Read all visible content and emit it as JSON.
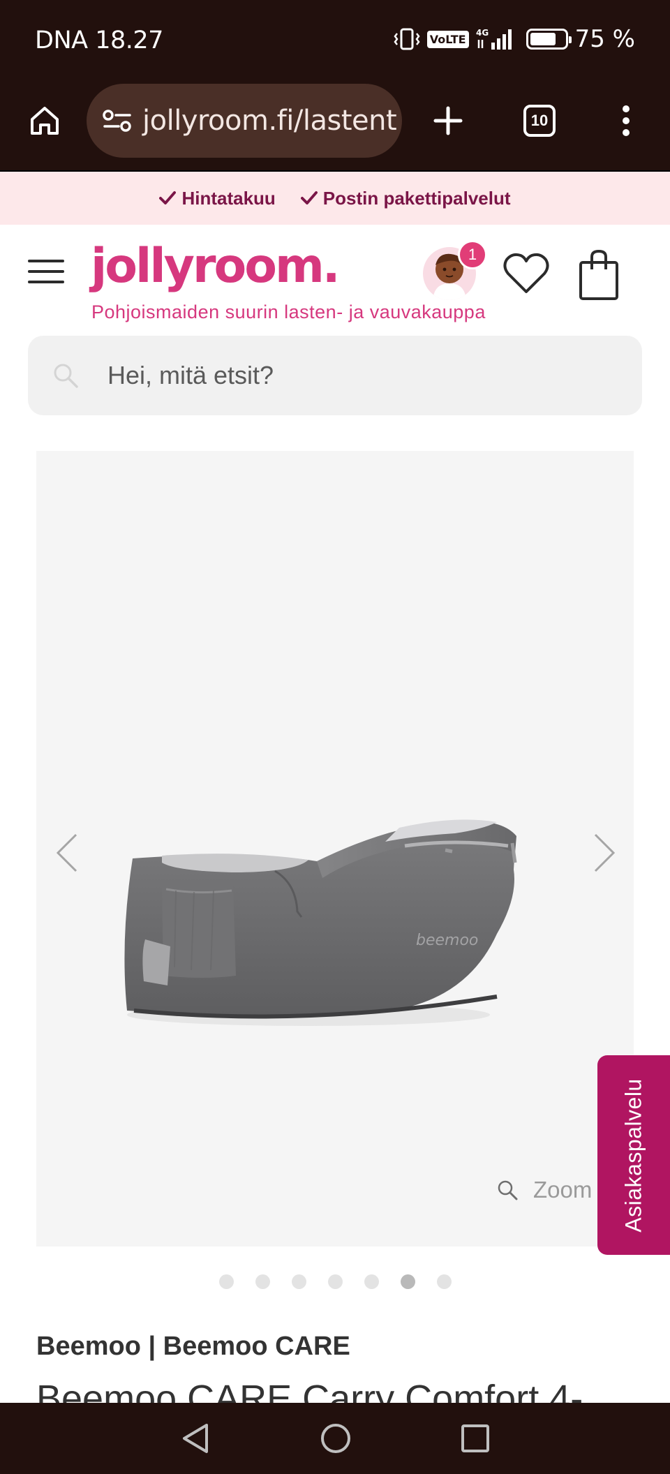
{
  "status_bar": {
    "carrier_time": "DNA 18.27",
    "network": "4G",
    "volte": "VoLTE",
    "battery_percent": "75 %",
    "battery_level": 0.75
  },
  "browser": {
    "url": "jollyroom.fi/lastent",
    "tab_count": "10"
  },
  "usp": {
    "items": [
      "Hintatakuu",
      "Postin pakettipalvelut"
    ]
  },
  "header": {
    "logo": "jollyroom.",
    "tagline": "Pohjoismaiden suurin lasten- ja vauvakauppa",
    "notification_count": "1"
  },
  "search": {
    "placeholder": "Hei, mitä etsit?"
  },
  "gallery": {
    "image_caption": "beemoo",
    "zoom_label": "Zoom",
    "slide_count": 7,
    "active_slide": 6
  },
  "customer_service": {
    "label": "Asiakaspalvelu"
  },
  "product": {
    "brand": "Beemoo | Beemoo CARE",
    "title": "Beemoo CARE Carry Comfort 4-"
  },
  "colors": {
    "brand_pink": "#d6387e",
    "dark_bar": "#22100d",
    "usp_bg": "#fde8ea",
    "usp_text": "#7a1547",
    "service_tab": "#b01561"
  }
}
